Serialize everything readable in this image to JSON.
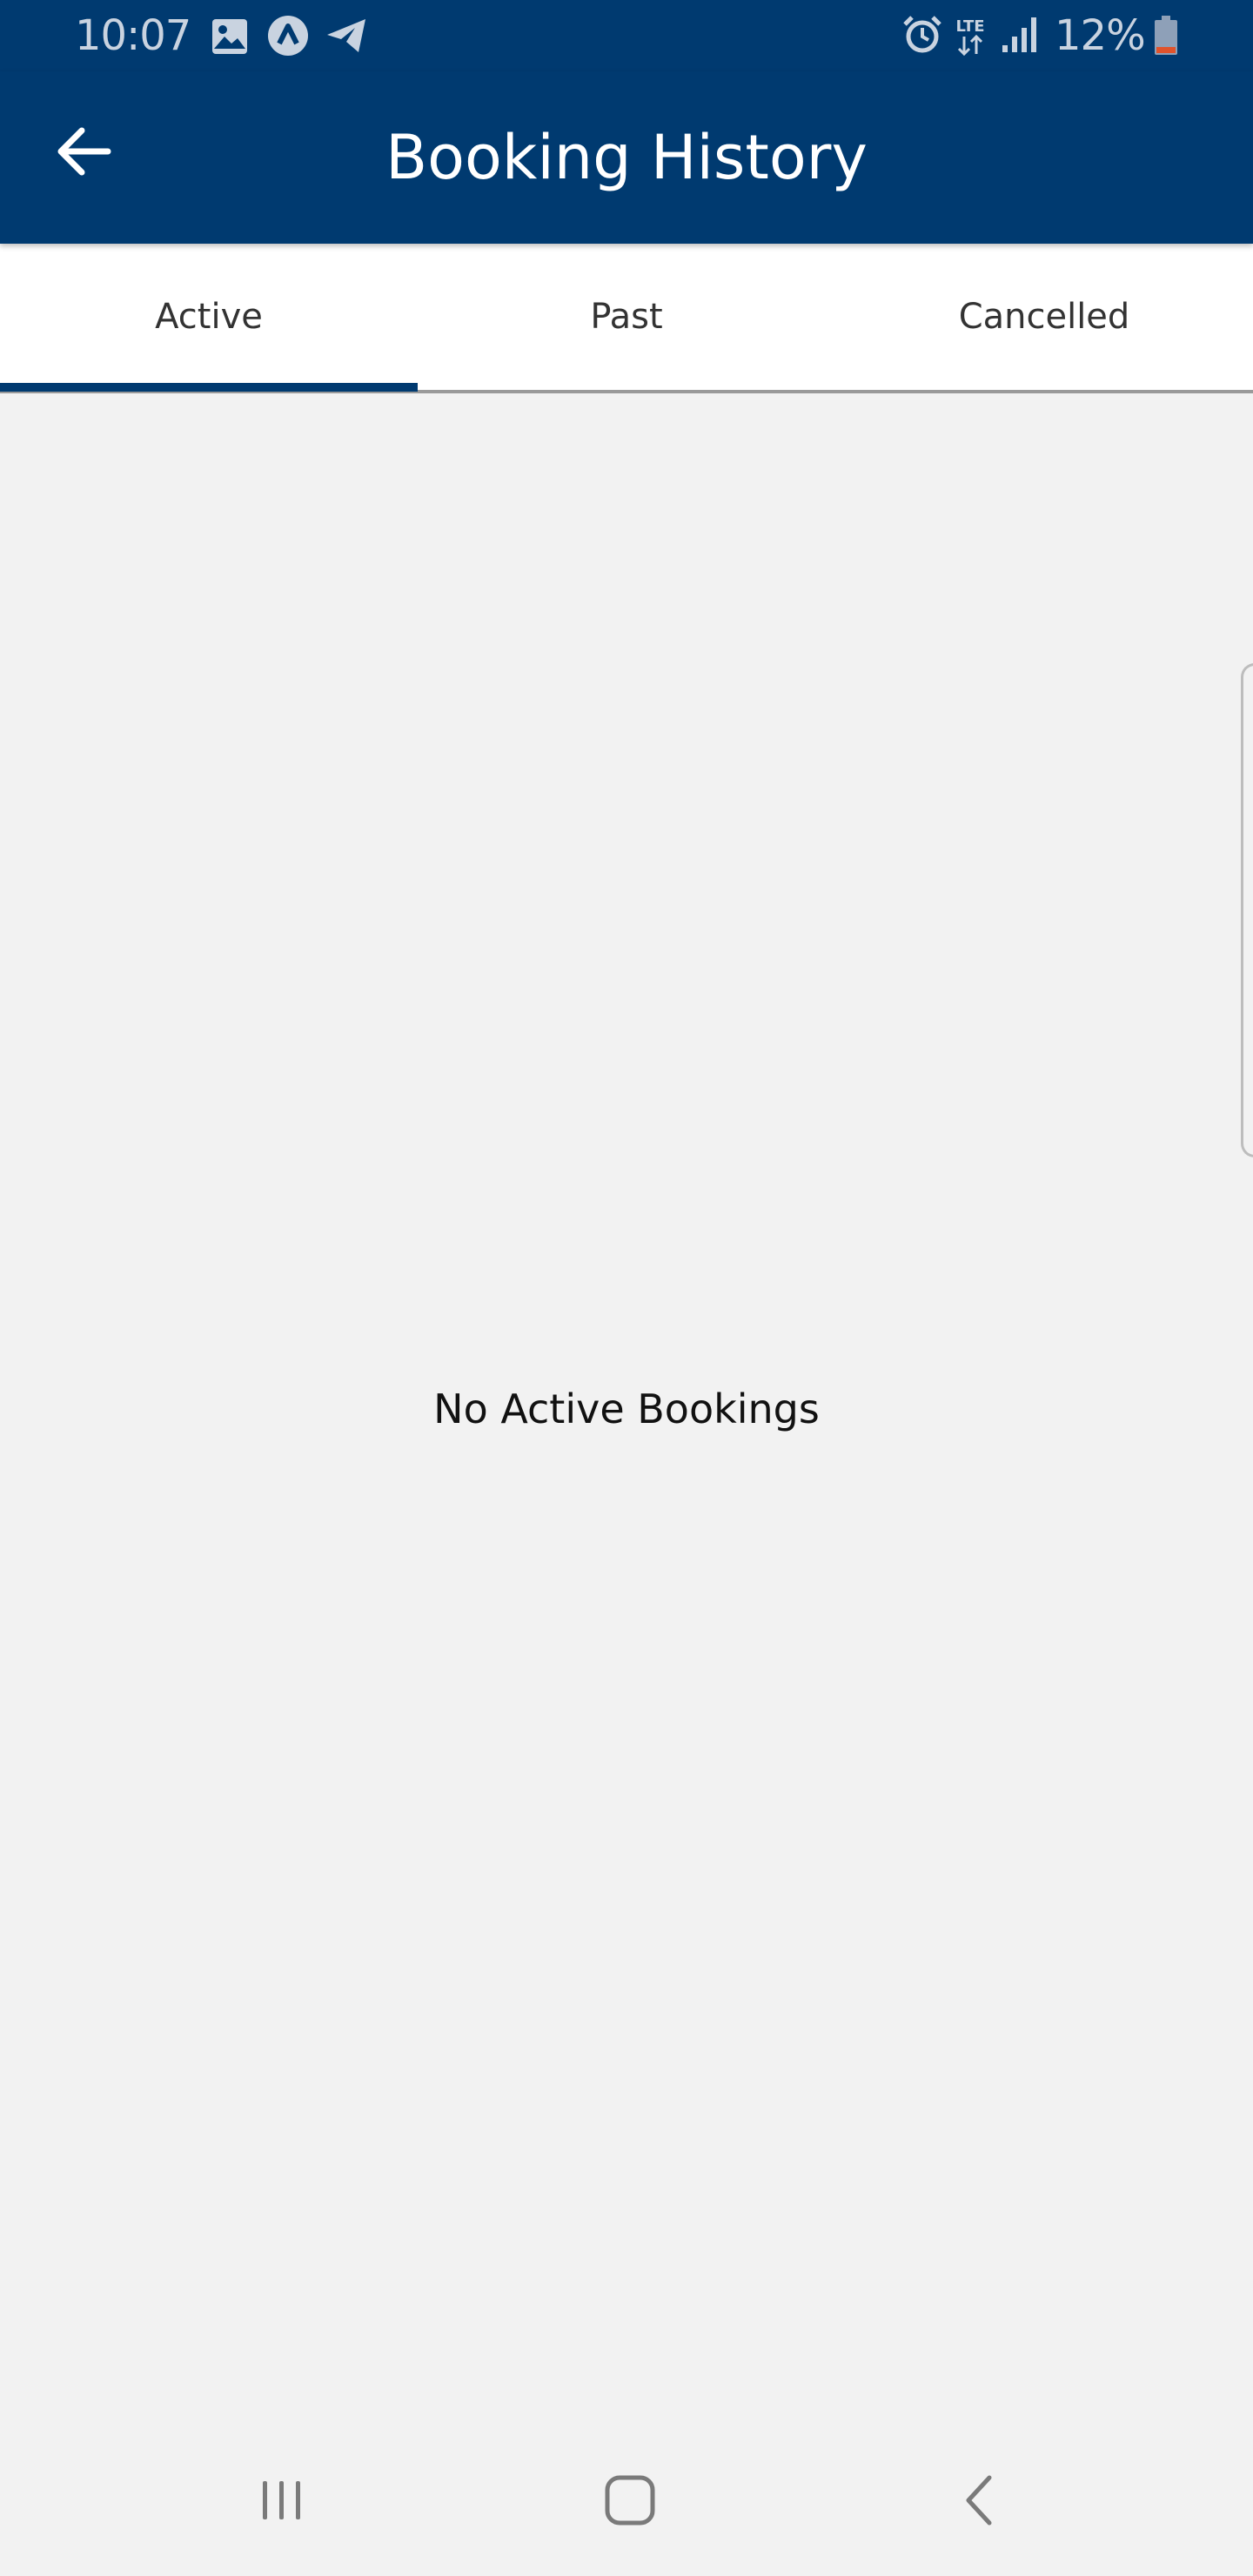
{
  "status_bar": {
    "time": "10:07",
    "battery_percent": "12%",
    "network_label": "LTE",
    "icons": [
      "gallery-icon",
      "app-notification-icon",
      "telegram-icon",
      "alarm-icon",
      "lte-data-icon",
      "signal-icon",
      "battery-icon"
    ]
  },
  "header": {
    "title": "Booking History",
    "back_icon": "arrow-left-icon"
  },
  "tabs": [
    {
      "label": "Active",
      "selected": true
    },
    {
      "label": "Past",
      "selected": false
    },
    {
      "label": "Cancelled",
      "selected": false
    }
  ],
  "main": {
    "empty_message": "No Active Bookings"
  },
  "nav_bar": {
    "icons": [
      "recent-apps-icon",
      "home-icon",
      "back-icon"
    ]
  },
  "colors": {
    "primary": "#003a70",
    "background": "#f2f2f2",
    "tab_background": "#ffffff",
    "battery_low": "#e0532c"
  }
}
